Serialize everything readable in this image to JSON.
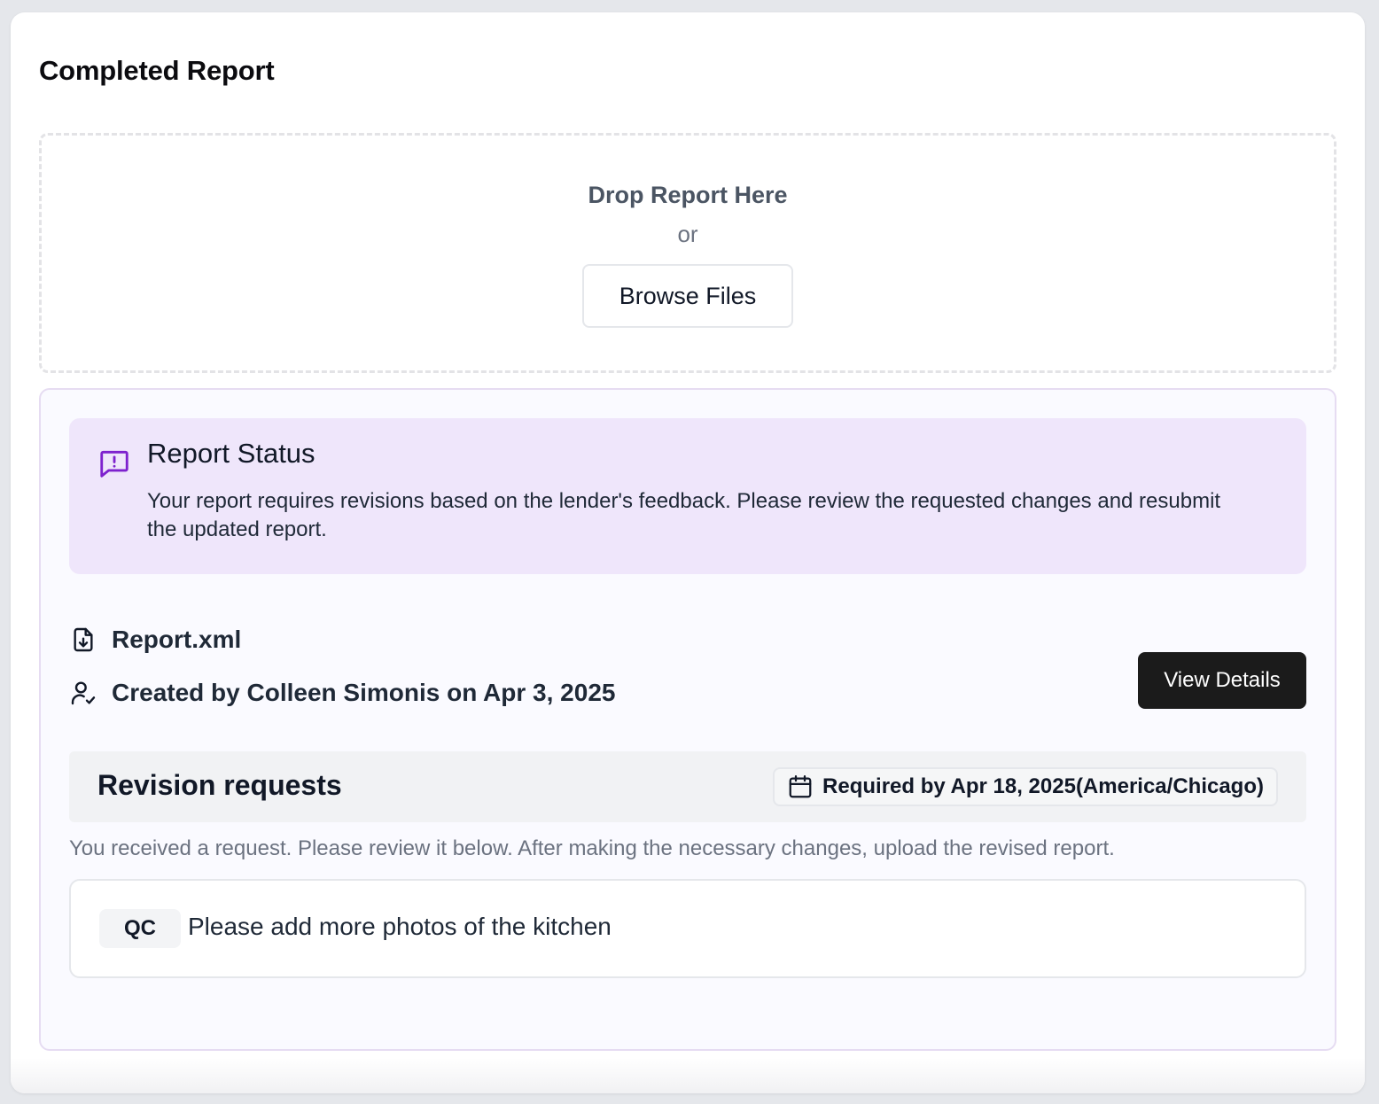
{
  "colors": {
    "accent_purple": "#7e22ce",
    "status_bg": "#efe6fb",
    "primary_button": "#1b1b1b"
  },
  "header": {
    "title": "Completed Report"
  },
  "upload": {
    "drop_label": "Drop Report Here",
    "or_label": "or",
    "browse_label": "Browse Files"
  },
  "status": {
    "icon": "message-alert-icon",
    "title": "Report Status",
    "message": "Your report requires revisions based on the lender's feedback. Please review the requested changes and resubmit the updated report."
  },
  "file": {
    "icon": "file-download-icon",
    "name": "Report.xml",
    "creator_icon": "user-check-icon",
    "created": "Created by Colleen Simonis on Apr 3, 2025",
    "view_label": "View Details"
  },
  "revisions": {
    "title": "Revision requests",
    "due_icon": "calendar-icon",
    "due_label": "Required by Apr 18, 2025(America/Chicago)",
    "hint": "You received a request. Please review it below. After making the necessary changes, upload the revised report.",
    "items": [
      {
        "tag": "QC",
        "text": "Please add more photos of the kitchen"
      }
    ]
  }
}
